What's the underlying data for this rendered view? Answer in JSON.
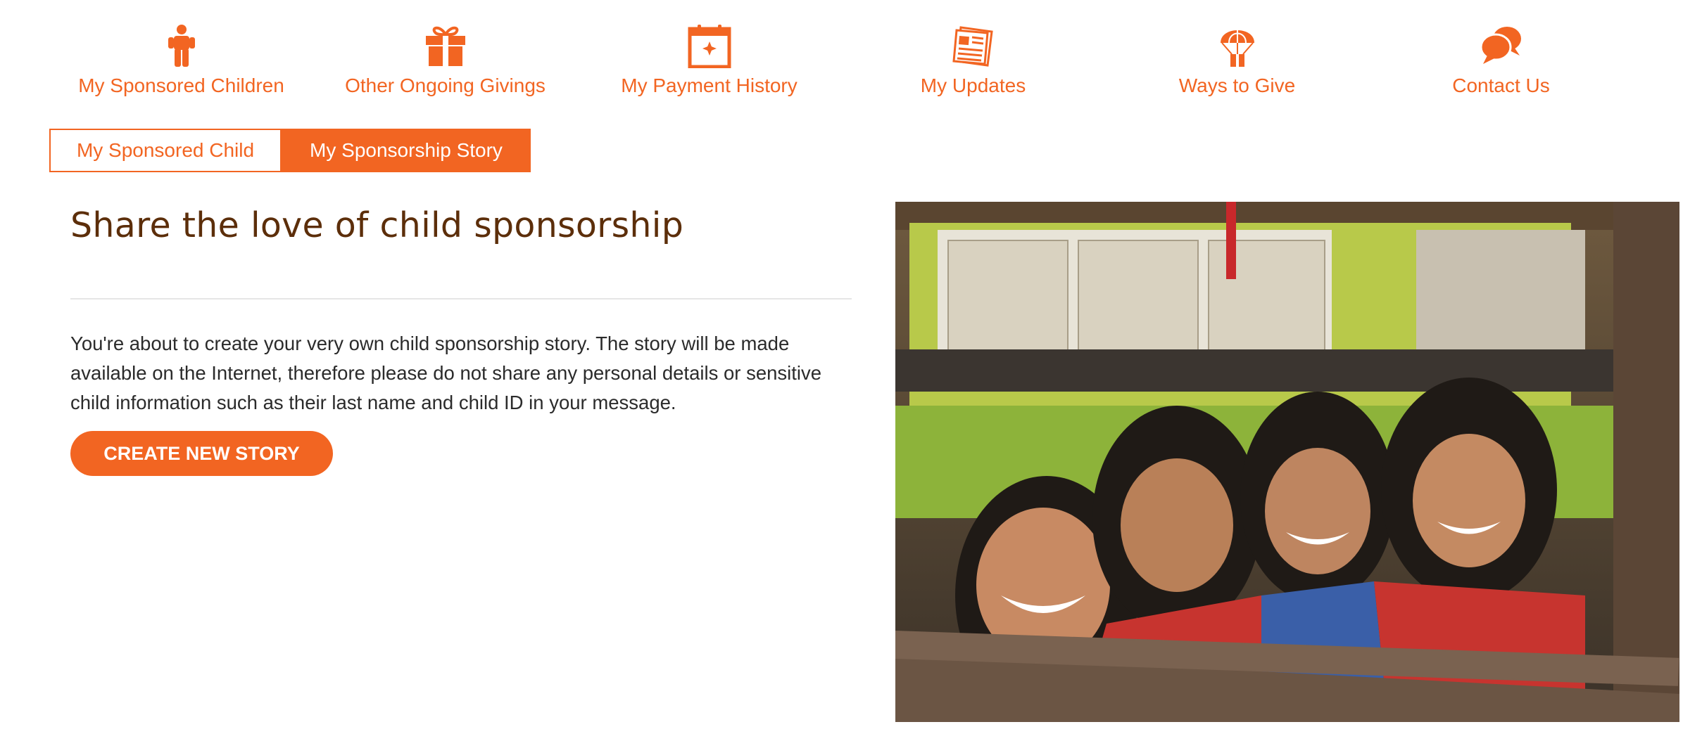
{
  "nav": {
    "items": [
      {
        "label": "My Sponsored Children",
        "icon": "child-icon"
      },
      {
        "label": "Other Ongoing Givings",
        "icon": "gift-icon"
      },
      {
        "label": "My Payment History",
        "icon": "calendar-icon"
      },
      {
        "label": "My Updates",
        "icon": "newspaper-icon"
      },
      {
        "label": "Ways to Give",
        "icon": "parachute-gift-icon"
      },
      {
        "label": "Contact Us",
        "icon": "chat-bubbles-icon"
      }
    ]
  },
  "tabs": [
    {
      "label": "My Sponsored Child",
      "active": false
    },
    {
      "label": "My Sponsorship Story",
      "active": true
    }
  ],
  "main": {
    "headline": "Share the love of child sponsorship",
    "intro": "You're about to create your very own child sponsorship story. The story will be made available on the Internet, therefore please do not share any personal details or sensitive child information such as their last name and child ID in your message.",
    "cta_label": "CREATE NEW STORY"
  },
  "colors": {
    "accent": "#f26522",
    "heading": "#5c2e0a",
    "body_text": "#2b2b2b",
    "divider": "#e6e6e6"
  }
}
